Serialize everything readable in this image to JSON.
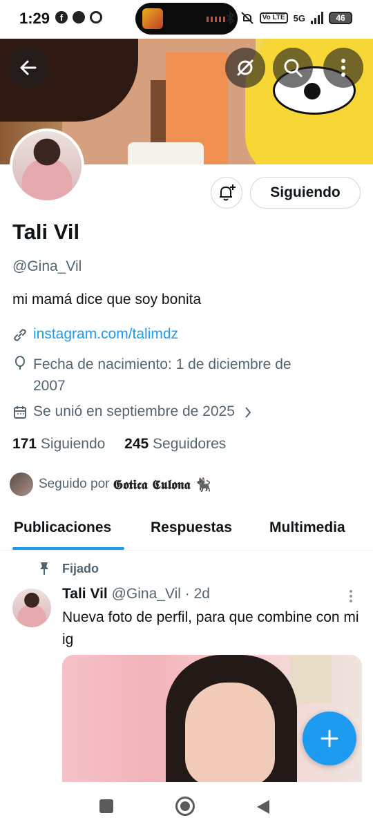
{
  "status_bar": {
    "time": "1:29",
    "network": "5G",
    "volte_label": "Vo LTE",
    "battery": "46"
  },
  "header": {
    "back_icon": "arrow-left-icon",
    "grok_icon": "circle-slash-icon",
    "search_icon": "search-icon",
    "more_icon": "more-vertical-icon"
  },
  "profile": {
    "follow_button_label": "Siguiendo",
    "display_name": "Tali Vil",
    "handle": "@Gina_Vil",
    "bio": "mi mamá dice que soy bonita",
    "website": "instagram.com/talimdz",
    "birthdate_line1": "Fecha de nacimiento: 1 de diciembre de",
    "birthdate_line2": "2007",
    "joined": "Se unió en septiembre de 2025",
    "following_count": "171",
    "following_label": "Siguiendo",
    "followers_count": "245",
    "followers_label": "Seguidores",
    "followed_by_prefix": "Seguido por",
    "followed_by_name": "𝕲𝖔𝖙𝖎𝖈𝖆 𝕮𝖚𝖑𝖔𝖓𝖆 🐈‍⬛"
  },
  "tabs": [
    {
      "label": "Publicaciones",
      "active": true
    },
    {
      "label": "Respuestas",
      "active": false
    },
    {
      "label": "Multimedia",
      "active": false
    }
  ],
  "post": {
    "pinned_label": "Fijado",
    "author_name": "Tali Vil",
    "author_handle": "@Gina_Vil",
    "time": "· 2d",
    "text": "Nueva foto de perfil, para que combine con mi ig"
  },
  "colors": {
    "accent": "#1d9bf0",
    "text_primary": "#0f1419",
    "text_secondary": "#536471"
  }
}
